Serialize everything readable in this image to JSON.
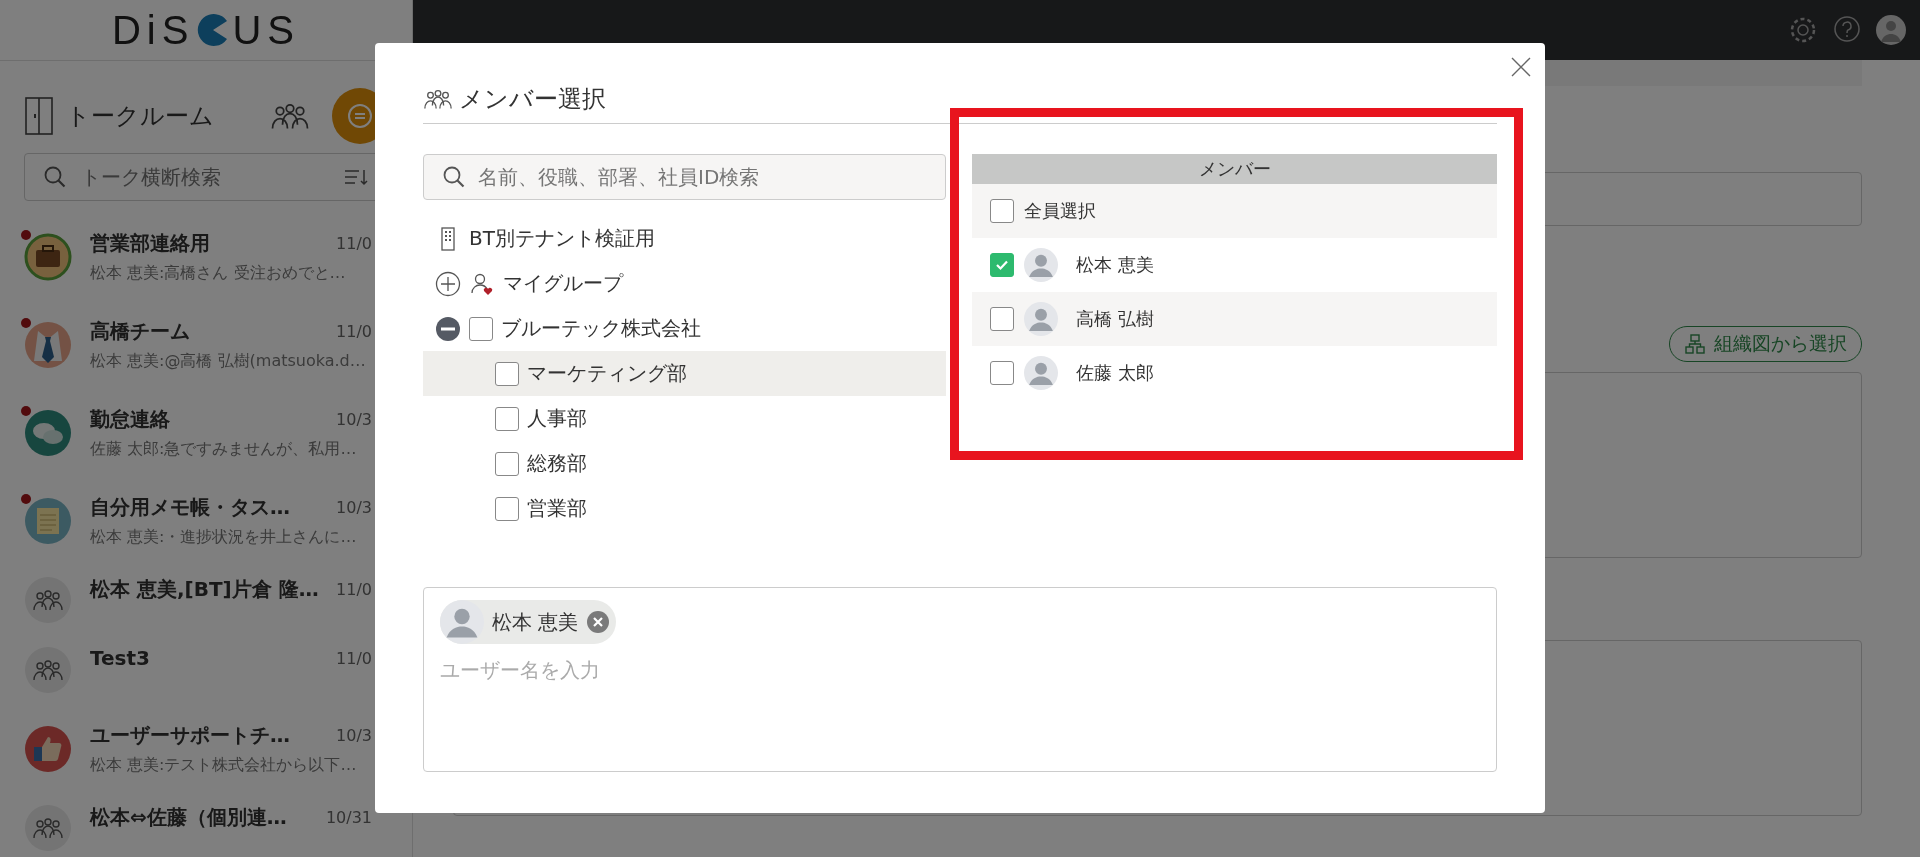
{
  "logo": {
    "before": "DiS",
    "after": "US"
  },
  "sidebar": {
    "title": "トークルーム",
    "search_placeholder": "トーク横断検索",
    "rooms": [
      {
        "name": "営業部連絡用",
        "date": "11/0",
        "preview": "松本 恵美:高橋さん 受注おめでと…",
        "unread": true,
        "kind": "briefcase"
      },
      {
        "name": "高橋チーム",
        "date": "11/0",
        "preview": "松本 恵美:@高橋 弘樹(matsuoka.d…",
        "unread": true,
        "kind": "tie"
      },
      {
        "name": "勤怠連絡",
        "date": "10/3",
        "preview": "佐藤 太郎:急ですみませんが、私用…",
        "unread": true,
        "kind": "chat"
      },
      {
        "name": "自分用メモ帳・タス…",
        "date": "10/3",
        "preview": "松本 恵美:・進捗状況を井上さんに…",
        "unread": true,
        "kind": "memo"
      },
      {
        "name": "松本 恵美,[BT]片倉 隆…",
        "date": "11/0",
        "unread": false,
        "kind": "group"
      },
      {
        "name": "Test3",
        "date": "11/0",
        "unread": false,
        "kind": "group"
      },
      {
        "name": "ユーザーサポートチ…",
        "date": "10/3",
        "preview": "松本 恵美:テスト株式会社から以下…",
        "unread": false,
        "kind": "thumb"
      },
      {
        "name": "松本⇔佐藤（個別連…",
        "date": "10/31",
        "unread": false,
        "kind": "group"
      }
    ]
  },
  "main": {
    "org_button": "組織図から選択"
  },
  "modal": {
    "title": "メンバー選択",
    "search_placeholder": "名前、役職、部署、社員ID検索",
    "tree": [
      {
        "label": "BT別テナント検証用",
        "kind": "tenant"
      },
      {
        "label": "マイグループ",
        "kind": "mygroup",
        "expanded": false
      },
      {
        "label": "ブルーテック株式会社",
        "kind": "company",
        "expanded": true,
        "checked": false,
        "children": [
          {
            "label": "マーケティング部",
            "checked": false,
            "selected": true
          },
          {
            "label": "人事部",
            "checked": false,
            "selected": false
          },
          {
            "label": "総務部",
            "checked": false,
            "selected": false
          },
          {
            "label": "営業部",
            "checked": false,
            "selected": false
          }
        ]
      }
    ],
    "members_header": "メンバー",
    "select_all": {
      "label": "全員選択",
      "checked": false
    },
    "members": [
      {
        "name": "松本 恵美",
        "checked": true
      },
      {
        "name": "高橋 弘樹",
        "checked": false
      },
      {
        "name": "佐藤 太郎",
        "checked": false
      }
    ],
    "chips": [
      {
        "name": "松本 恵美"
      }
    ],
    "input_placeholder": "ユーザー名を入力"
  }
}
